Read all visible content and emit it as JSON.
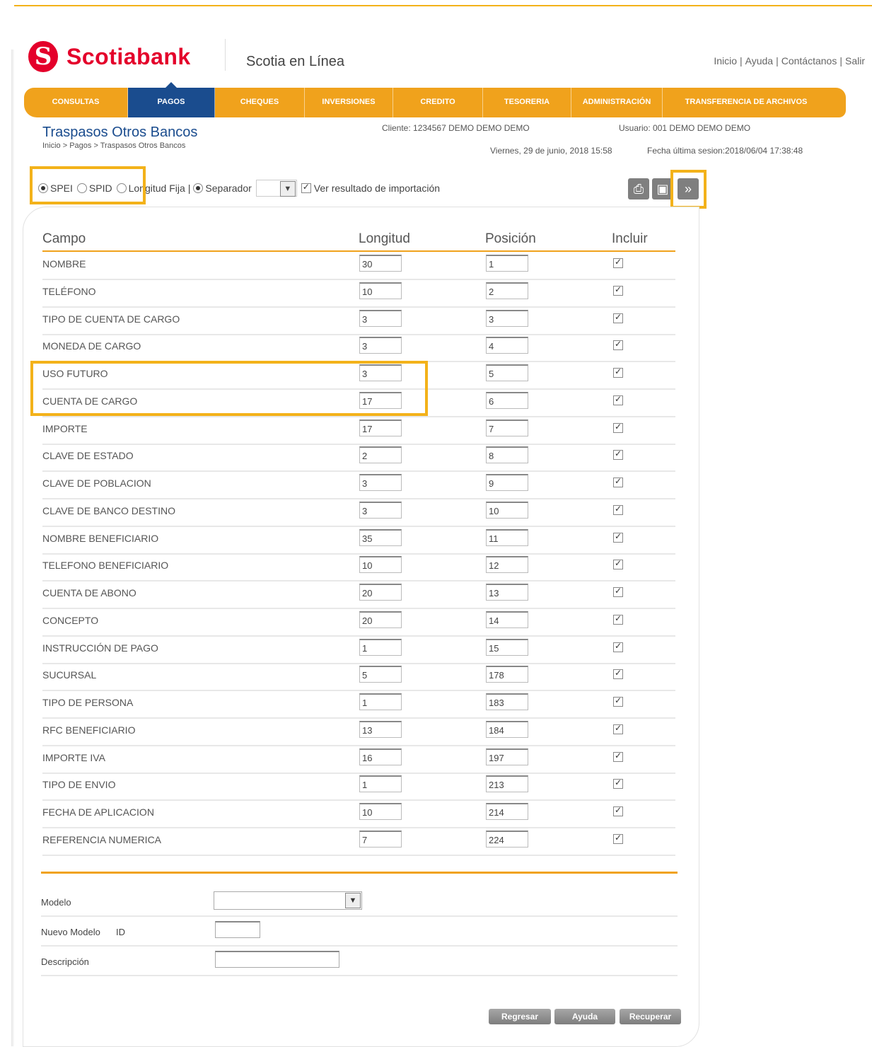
{
  "brand": {
    "name": "Scotiabank",
    "product": "Scotia en Línea",
    "color": "#e4002b"
  },
  "toplinks": [
    "Inicio",
    "Ayuda",
    "Contáctanos",
    "Salir"
  ],
  "nav": [
    "CONSULTAS",
    "PAGOS",
    "CHEQUES",
    "INVERSIONES",
    "CREDITO",
    "TESORERIA",
    "ADMINISTRACIÓN",
    "TRANSFERENCIA DE ARCHIVOS"
  ],
  "nav_active": "PAGOS",
  "page": {
    "title": "Traspasos Otros Bancos",
    "breadcrumb": "Inicio > Pagos > Traspasos Otros Bancos",
    "cliente": "Cliente:   1234567 DEMO DEMO DEMO",
    "usuario": "Usuario:   001 DEMO DEMO DEMO",
    "fecha": "Viernes, 29 de junio, 2018 15:58",
    "ultima_sesion": "Fecha última sesion:2018/06/04 17:38:48"
  },
  "options": {
    "spei": "SPEI",
    "spid": "SPID",
    "longitud_fija": "Longitud Fija",
    "separador": "Separador",
    "ver_resultado": "Ver resultado de importación"
  },
  "table": {
    "headers": {
      "campo": "Campo",
      "longitud": "Longitud",
      "posicion": "Posición",
      "incluir": "Incluir"
    },
    "rows": [
      {
        "campo": "NOMBRE",
        "longitud": "30",
        "posicion": "1"
      },
      {
        "campo": "TELÉFONO",
        "longitud": "10",
        "posicion": "2"
      },
      {
        "campo": "TIPO DE CUENTA DE CARGO",
        "longitud": "3",
        "posicion": "3"
      },
      {
        "campo": "MONEDA DE CARGO",
        "longitud": "3",
        "posicion": "4"
      },
      {
        "campo": "USO FUTURO",
        "longitud": "3",
        "posicion": "5"
      },
      {
        "campo": "CUENTA DE CARGO",
        "longitud": "17",
        "posicion": "6"
      },
      {
        "campo": "IMPORTE",
        "longitud": "17",
        "posicion": "7"
      },
      {
        "campo": "CLAVE DE ESTADO",
        "longitud": "2",
        "posicion": "8"
      },
      {
        "campo": "CLAVE DE POBLACION",
        "longitud": "3",
        "posicion": "9"
      },
      {
        "campo": "CLAVE DE BANCO DESTINO",
        "longitud": "3",
        "posicion": "10"
      },
      {
        "campo": "NOMBRE BENEFICIARIO",
        "longitud": "35",
        "posicion": "11"
      },
      {
        "campo": "TELEFONO BENEFICIARIO",
        "longitud": "10",
        "posicion": "12"
      },
      {
        "campo": "CUENTA DE ABONO",
        "longitud": "20",
        "posicion": "13"
      },
      {
        "campo": "CONCEPTO",
        "longitud": "20",
        "posicion": "14"
      },
      {
        "campo": "INSTRUCCIÓN DE PAGO",
        "longitud": "1",
        "posicion": "15"
      },
      {
        "campo": "SUCURSAL",
        "longitud": "5",
        "posicion": "178"
      },
      {
        "campo": "TIPO DE PERSONA",
        "longitud": "1",
        "posicion": "183"
      },
      {
        "campo": "RFC BENEFICIARIO",
        "longitud": "13",
        "posicion": "184"
      },
      {
        "campo": "IMPORTE IVA",
        "longitud": "16",
        "posicion": "197"
      },
      {
        "campo": "TIPO DE ENVIO",
        "longitud": "1",
        "posicion": "213"
      },
      {
        "campo": "FECHA DE APLICACION",
        "longitud": "10",
        "posicion": "214"
      },
      {
        "campo": "REFERENCIA NUMERICA",
        "longitud": "7",
        "posicion": "224"
      }
    ]
  },
  "form": {
    "modelo": "Modelo",
    "nuevo_modelo": "Nuevo Modelo",
    "id": "ID",
    "descripcion": "Descripción"
  },
  "buttons": {
    "regresar": "Regresar",
    "ayuda": "Ayuda",
    "recuperar": "Recuperar"
  },
  "highlight_color": "#f3b21a"
}
